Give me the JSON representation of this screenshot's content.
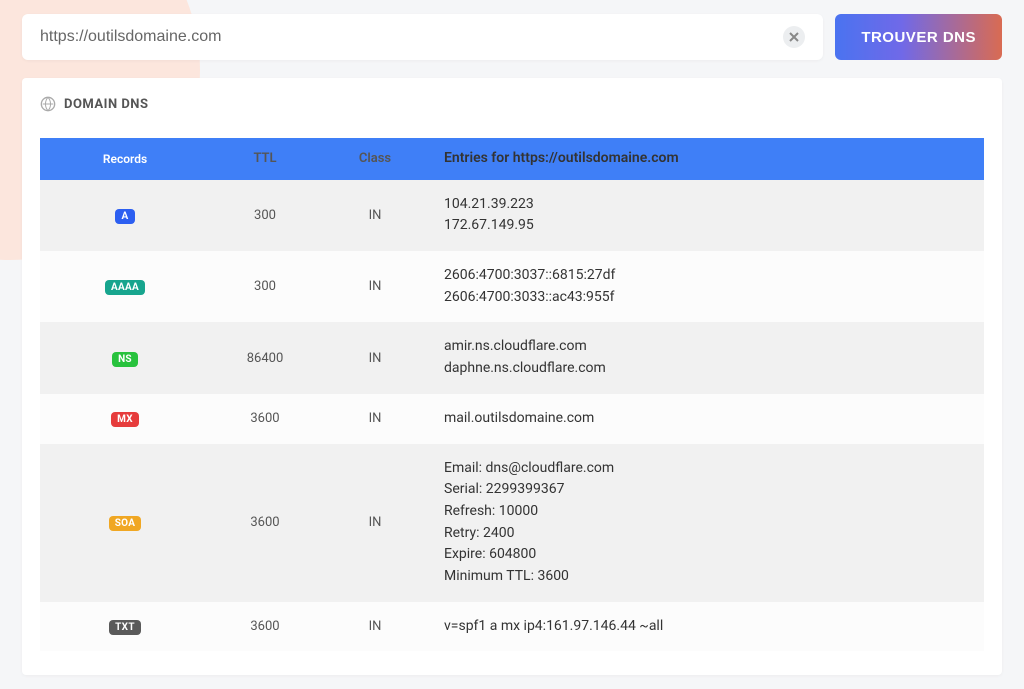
{
  "search": {
    "value": "https://outilsdomaine.com",
    "submit_label": "TROUVER DNS"
  },
  "panel": {
    "title": "DOMAIN DNS"
  },
  "table": {
    "headers": {
      "records": "Records",
      "ttl": "TTL",
      "class": "Class",
      "entries": "Entries for https://outilsdomaine.com"
    },
    "rows": [
      {
        "type": "A",
        "badge_class": "badge-a",
        "ttl": "300",
        "class": "IN",
        "entries": [
          "104.21.39.223",
          "172.67.149.95"
        ]
      },
      {
        "type": "AAAA",
        "badge_class": "badge-aaaa",
        "ttl": "300",
        "class": "IN",
        "entries": [
          "2606:4700:3037::6815:27df",
          "2606:4700:3033::ac43:955f"
        ]
      },
      {
        "type": "NS",
        "badge_class": "badge-ns",
        "ttl": "86400",
        "class": "IN",
        "entries": [
          "amir.ns.cloudflare.com",
          "daphne.ns.cloudflare.com"
        ]
      },
      {
        "type": "MX",
        "badge_class": "badge-mx",
        "ttl": "3600",
        "class": "IN",
        "entries": [
          "mail.outilsdomaine.com"
        ]
      },
      {
        "type": "SOA",
        "badge_class": "badge-soa",
        "ttl": "3600",
        "class": "IN",
        "entries": [
          "Email: dns@cloudflare.com",
          "Serial: 2299399367",
          "Refresh: 10000",
          "Retry: 2400",
          "Expire: 604800",
          "Minimum TTL: 3600"
        ]
      },
      {
        "type": "TXT",
        "badge_class": "badge-txt",
        "ttl": "3600",
        "class": "IN",
        "entries": [
          "v=spf1 a mx ip4:161.97.146.44 ~all"
        ]
      }
    ]
  }
}
